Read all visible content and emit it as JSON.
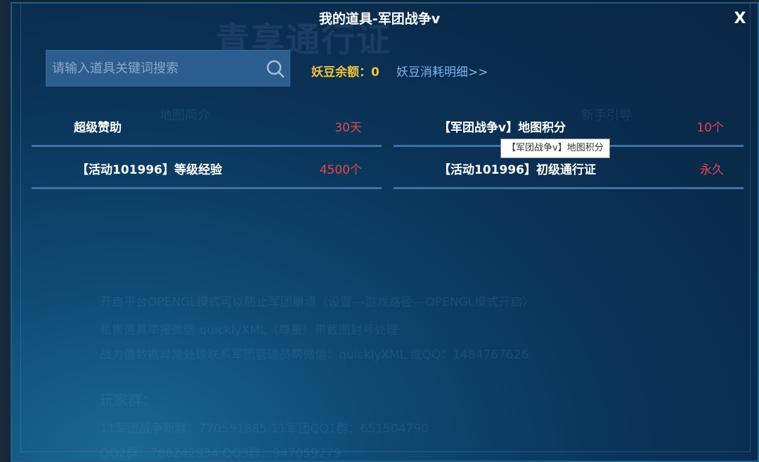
{
  "dialog": {
    "title": "我的道具-军团战争v",
    "close_label": "X"
  },
  "search": {
    "placeholder": "请输入道具关键词搜索",
    "value": ""
  },
  "balance": {
    "label": "妖豆余额：0",
    "details_link": "妖豆消耗明细>>"
  },
  "items": [
    {
      "name": "超级赞助",
      "quantity": "30天"
    },
    {
      "name": "【军团战争v】地图积分",
      "quantity": "10个"
    },
    {
      "name": "【活动101996】等级经验",
      "quantity": "4500个"
    },
    {
      "name": "【活动101996】初级通行证",
      "quantity": "永久"
    }
  ],
  "tooltip": "【军团战争v】地图积分",
  "background": {
    "banner": "青享通行证",
    "tab_left": "地图简介",
    "tab_right": "新手引导",
    "lines": [
      "开启平台OPENGL模式可以防止军团崩溃（设置---游戏路径---OPENGL模式开启）",
      "私售道具举报微信 quicklyXML（尊重）带截图封号处理",
      "战力值数据异常处理联系军团管理员帮微信：quicklyXML 或QQ：1484767626",
      "玩家群：",
      "11军团战争新群：770591885      11军团QQ1群：651504790",
      "QQ2群：786242934                QQ3群：947059279"
    ]
  },
  "colors": {
    "title_text": "#ffffff",
    "balance_text": "#f0c23a",
    "link_text": "#7fb4ee",
    "quantity_text": "#e2474a",
    "divider": "#4070a6"
  }
}
